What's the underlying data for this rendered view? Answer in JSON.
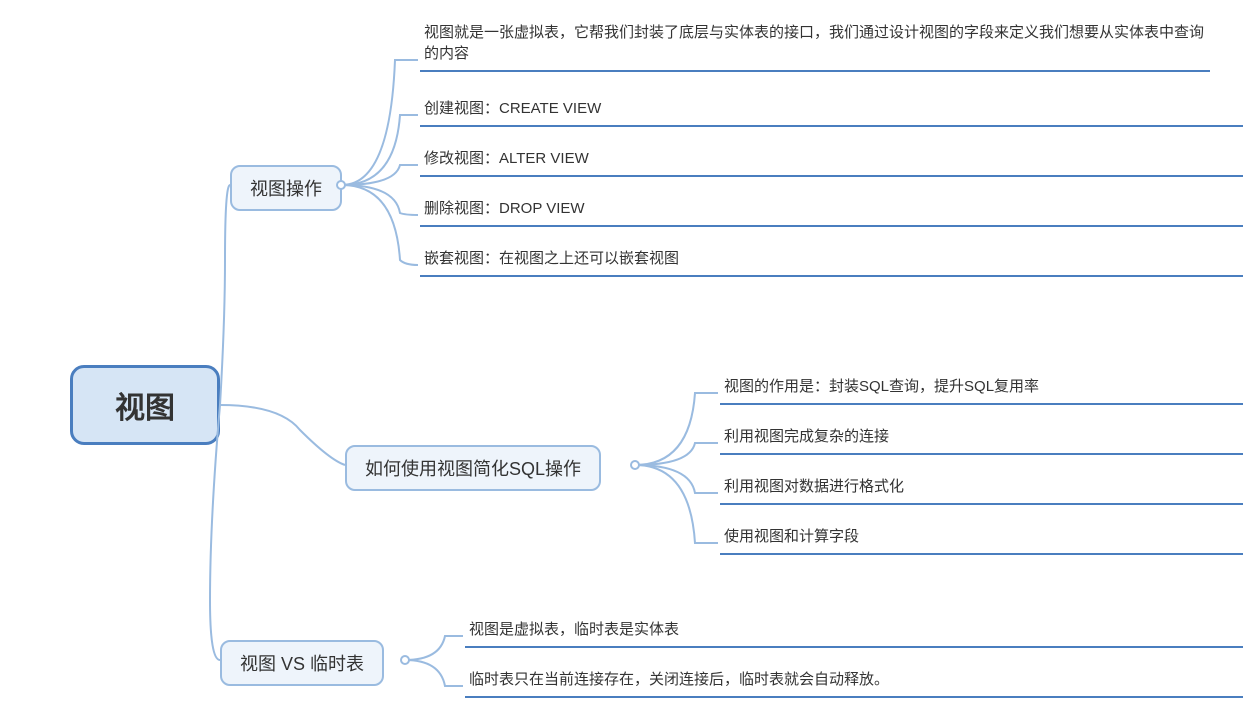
{
  "root": {
    "label": "视图"
  },
  "branches": [
    {
      "label": "视图操作",
      "leaves": [
        "视图就是一张虚拟表，它帮我们封装了底层与实体表的接口，我们通过设计视图的字段来定义我们想要从实体表中查询的内容",
        "创建视图：CREATE VIEW",
        "修改视图：ALTER VIEW",
        "删除视图：DROP VIEW",
        "嵌套视图：在视图之上还可以嵌套视图"
      ]
    },
    {
      "label": "如何使用视图简化SQL操作",
      "leaves": [
        "视图的作用是：封装SQL查询，提升SQL复用率",
        "利用视图完成复杂的连接",
        "利用视图对数据进行格式化",
        "使用视图和计算字段"
      ]
    },
    {
      "label": "视图 VS 临时表",
      "leaves": [
        "视图是虚拟表，临时表是实体表",
        "临时表只在当前连接存在，关闭连接后，临时表就会自动释放。"
      ]
    }
  ]
}
